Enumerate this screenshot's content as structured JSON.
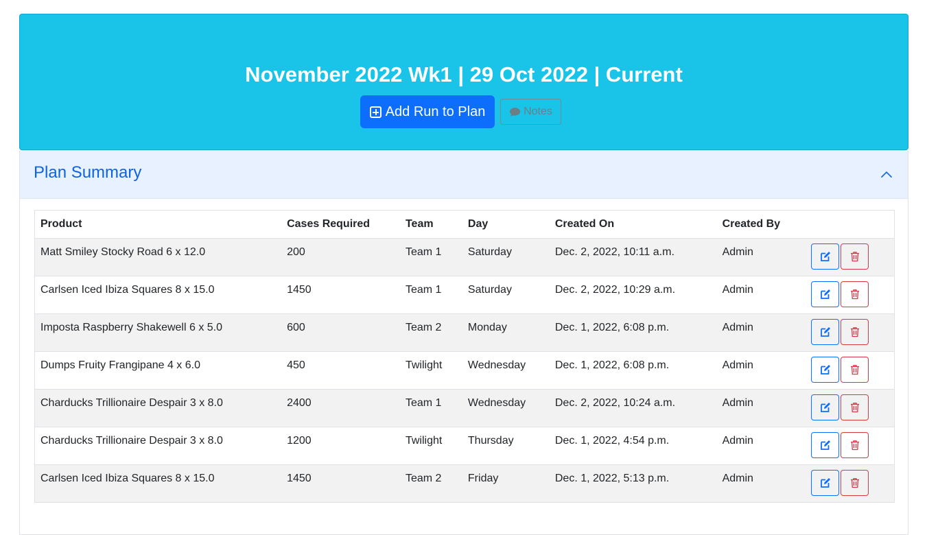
{
  "header": {
    "title": "November 2022 Wk1 | 29 Oct 2022 | Current",
    "add_run_label": "Add Run to Plan",
    "notes_label": "Notes"
  },
  "summary": {
    "title": "Plan Summary",
    "columns": [
      "Product",
      "Cases Required",
      "Team",
      "Day",
      "Created On",
      "Created By"
    ],
    "rows": [
      {
        "product": "Matt Smiley Stocky Road 6 x 12.0",
        "cases": "200",
        "team": "Team 1",
        "day": "Saturday",
        "created_on": "Dec. 2, 2022, 10:11 a.m.",
        "created_by": "Admin"
      },
      {
        "product": "Carlsen Iced Ibiza Squares 8 x 15.0",
        "cases": "1450",
        "team": "Team 1",
        "day": "Saturday",
        "created_on": "Dec. 2, 2022, 10:29 a.m.",
        "created_by": "Admin"
      },
      {
        "product": "Imposta Raspberry Shakewell 6 x 5.0",
        "cases": "600",
        "team": "Team 2",
        "day": "Monday",
        "created_on": "Dec. 1, 2022, 6:08 p.m.",
        "created_by": "Admin"
      },
      {
        "product": "Dumps Fruity Frangipane 4 x 6.0",
        "cases": "450",
        "team": "Twilight",
        "day": "Wednesday",
        "created_on": "Dec. 1, 2022, 6:08 p.m.",
        "created_by": "Admin"
      },
      {
        "product": "Charducks Trillionaire Despair 3 x 8.0",
        "cases": "2400",
        "team": "Team 1",
        "day": "Wednesday",
        "created_on": "Dec. 2, 2022, 10:24 a.m.",
        "created_by": "Admin"
      },
      {
        "product": "Charducks Trillionaire Despair 3 x 8.0",
        "cases": "1200",
        "team": "Twilight",
        "day": "Thursday",
        "created_on": "Dec. 1, 2022, 4:54 p.m.",
        "created_by": "Admin"
      },
      {
        "product": "Carlsen Iced Ibiza Squares 8 x 15.0",
        "cases": "1450",
        "team": "Team 2",
        "day": "Friday",
        "created_on": "Dec. 1, 2022, 5:13 p.m.",
        "created_by": "Admin"
      }
    ]
  },
  "icons": {
    "add": "plus-square-icon",
    "notes": "speech-bubble-icon",
    "collapse": "chevron-up-icon",
    "edit": "pencil-square-icon",
    "delete": "trash-icon"
  },
  "colors": {
    "hero_bg": "#1ac4e9",
    "primary": "#0d6efd",
    "danger": "#dc3545",
    "header_bg": "#e7f1ff",
    "title_blue": "#0c63e4"
  }
}
